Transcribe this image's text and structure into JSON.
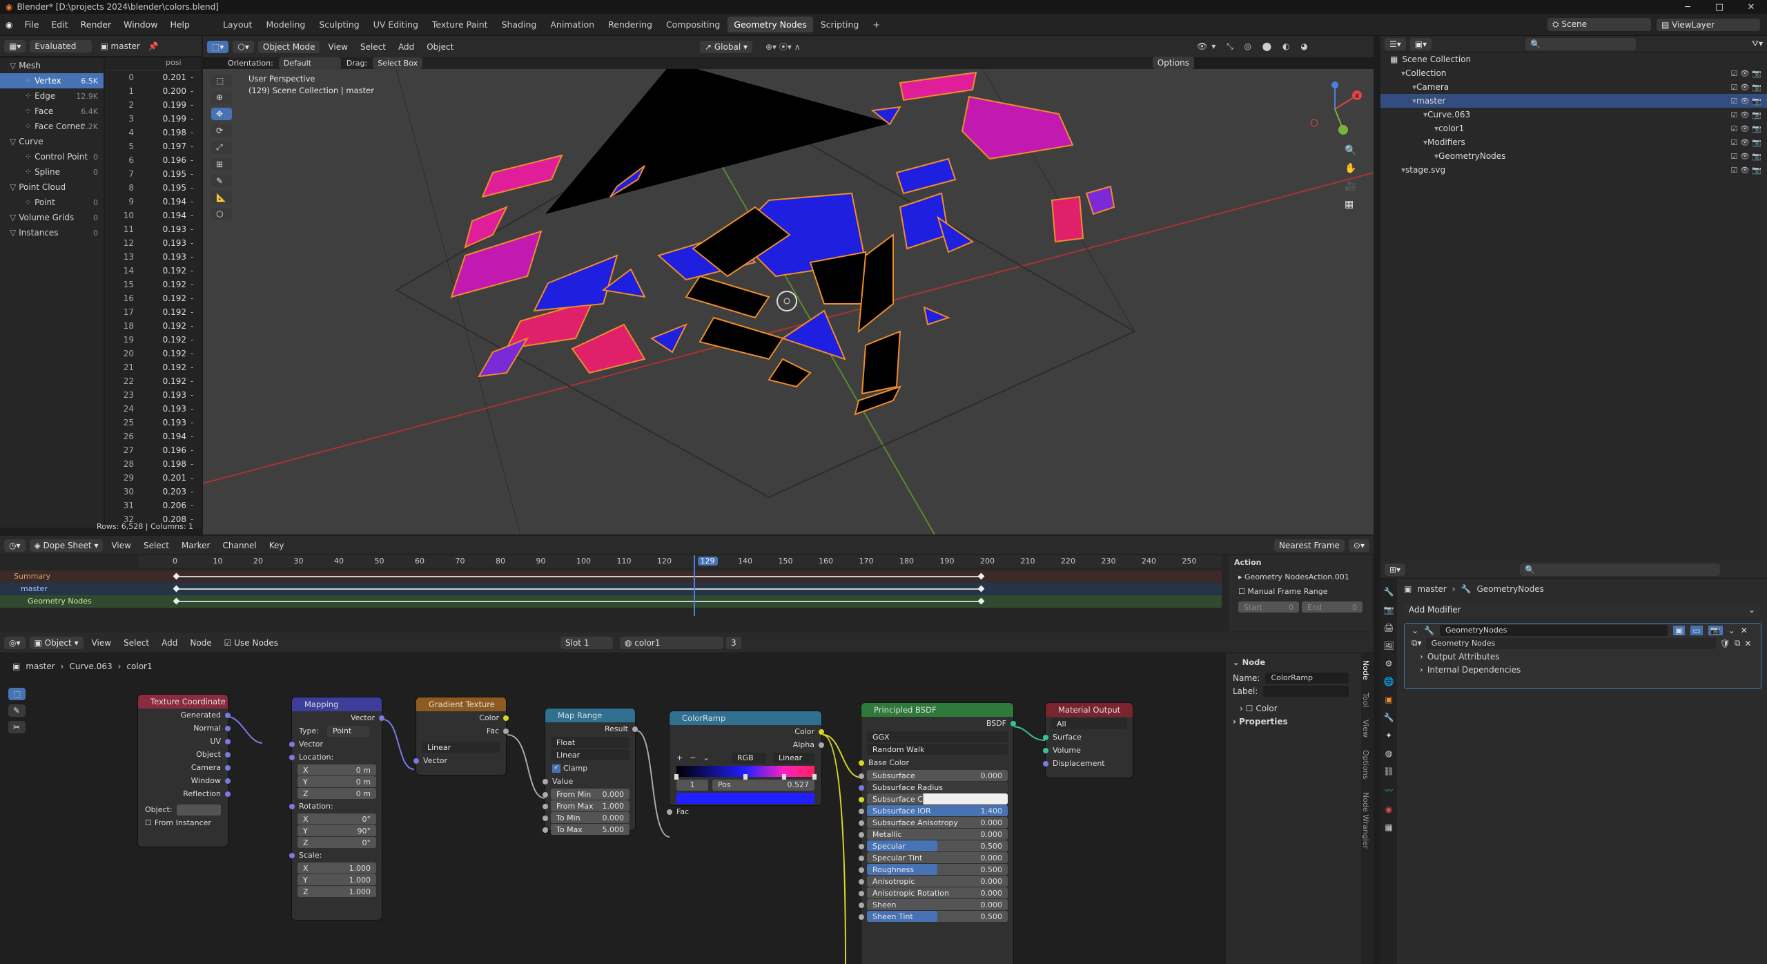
{
  "window": {
    "title": "Blender* [D:\\projects 2024\\blender\\colors.blend]",
    "minimize": "─",
    "maximize": "□",
    "close": "✕"
  },
  "menu": [
    "File",
    "Edit",
    "Render",
    "Window",
    "Help"
  ],
  "workspaces": [
    "Layout",
    "Modeling",
    "Sculpting",
    "UV Editing",
    "Texture Paint",
    "Shading",
    "Animation",
    "Rendering",
    "Compositing",
    "Geometry Nodes",
    "Scripting",
    "+"
  ],
  "active_workspace": "Geometry Nodes",
  "topright": {
    "scene": "Scene",
    "viewlayer": "ViewLayer"
  },
  "spreadsheet": {
    "mode": "Evaluated",
    "object": "master",
    "column_header": "posi",
    "tree": [
      {
        "label": "Mesh",
        "count": "",
        "indent": 0
      },
      {
        "label": "Vertex",
        "count": "6.5K",
        "indent": 1,
        "selected": true
      },
      {
        "label": "Edge",
        "count": "12.9K",
        "indent": 1
      },
      {
        "label": "Face",
        "count": "6.4K",
        "indent": 1
      },
      {
        "label": "Face Corner",
        "count": "2.2K",
        "indent": 1
      },
      {
        "label": "Curve",
        "count": "",
        "indent": 0
      },
      {
        "label": "Control Point",
        "count": "0",
        "indent": 1
      },
      {
        "label": "Spline",
        "count": "0",
        "indent": 1
      },
      {
        "label": "Point Cloud",
        "count": "",
        "indent": 0
      },
      {
        "label": "Point",
        "count": "0",
        "indent": 1
      },
      {
        "label": "Volume Grids",
        "count": "0",
        "indent": 0
      },
      {
        "label": "Instances",
        "count": "0",
        "indent": 0
      }
    ],
    "rows": [
      [
        "0",
        "0.201"
      ],
      [
        "1",
        "0.200"
      ],
      [
        "2",
        "0.199"
      ],
      [
        "3",
        "0.199"
      ],
      [
        "4",
        "0.198"
      ],
      [
        "5",
        "0.197"
      ],
      [
        "6",
        "0.196"
      ],
      [
        "7",
        "0.195"
      ],
      [
        "8",
        "0.195"
      ],
      [
        "9",
        "0.194"
      ],
      [
        "10",
        "0.194"
      ],
      [
        "11",
        "0.193"
      ],
      [
        "12",
        "0.193"
      ],
      [
        "13",
        "0.193"
      ],
      [
        "14",
        "0.192"
      ],
      [
        "15",
        "0.192"
      ],
      [
        "16",
        "0.192"
      ],
      [
        "17",
        "0.192"
      ],
      [
        "18",
        "0.192"
      ],
      [
        "19",
        "0.192"
      ],
      [
        "20",
        "0.192"
      ],
      [
        "21",
        "0.192"
      ],
      [
        "22",
        "0.192"
      ],
      [
        "23",
        "0.193"
      ],
      [
        "24",
        "0.193"
      ],
      [
        "25",
        "0.193"
      ],
      [
        "26",
        "0.194"
      ],
      [
        "27",
        "0.196"
      ],
      [
        "28",
        "0.198"
      ],
      [
        "29",
        "0.201"
      ],
      [
        "30",
        "0.203"
      ],
      [
        "31",
        "0.206"
      ],
      [
        "32",
        "0.208"
      ]
    ],
    "trailing": "-",
    "status": "Rows: 6,528  |  Columns: 1"
  },
  "viewport_header": {
    "mode": "Object Mode",
    "view": "View",
    "select": "Select",
    "add": "Add",
    "object": "Object",
    "orientation_label": "Orientation:",
    "orientation": "Default",
    "drag_label": "Drag:",
    "drag": "Select Box",
    "transform": "Global",
    "options": "Options"
  },
  "viewport_overlay": {
    "perspective": "User Perspective",
    "collection": "(129) Scene Collection | master"
  },
  "axis_labels": {
    "x": "X",
    "y": "Y",
    "z": "Z"
  },
  "outliner": {
    "root": "Scene Collection",
    "items": [
      {
        "label": "Collection",
        "indent": 1
      },
      {
        "label": "Camera",
        "indent": 2
      },
      {
        "label": "master",
        "indent": 2,
        "selected": true
      },
      {
        "label": "Curve.063",
        "indent": 3
      },
      {
        "label": "color1",
        "indent": 4
      },
      {
        "label": "Modifiers",
        "indent": 3
      },
      {
        "label": "GeometryNodes",
        "indent": 4
      },
      {
        "label": "stage.svg",
        "indent": 1
      }
    ]
  },
  "dopesheet": {
    "mode": "Dope Sheet",
    "menus": [
      "View",
      "Select",
      "Marker",
      "Channel",
      "Key"
    ],
    "snap": "Nearest Frame",
    "frames": [
      "0",
      "10",
      "20",
      "30",
      "40",
      "50",
      "60",
      "70",
      "80",
      "90",
      "100",
      "110",
      "120",
      "129",
      "140",
      "150",
      "160",
      "170",
      "180",
      "190",
      "200",
      "210",
      "220",
      "230",
      "240",
      "250"
    ],
    "current_frame": "129",
    "channels": [
      "Summary",
      "master",
      "Geometry Nodes"
    ],
    "action_panel": {
      "title": "Action",
      "name": "Geometry NodesAction.001",
      "manual": "Manual Frame Range",
      "start_label": "Start",
      "start": "0",
      "end_label": "End",
      "end": "0"
    }
  },
  "node_editor": {
    "mode": "Object",
    "menus": [
      "View",
      "Select",
      "Add",
      "Node"
    ],
    "use_nodes": "Use Nodes",
    "slot": "Slot 1",
    "material": "color1",
    "users": "3",
    "breadcrumb": [
      "master",
      "Curve.063",
      "color1"
    ],
    "tex_coord": {
      "title": "Texture Coordinate",
      "outputs": [
        "Generated",
        "Normal",
        "UV",
        "Object",
        "Camera",
        "Window",
        "Reflection"
      ],
      "object_label": "Object:",
      "from_instancer": "From Instancer"
    },
    "mapping": {
      "title": "Mapping",
      "out": "Vector",
      "type_label": "Type:",
      "type": "Point",
      "vector": "Vector",
      "location": "Location:",
      "loc": [
        [
          "X",
          "0 m"
        ],
        [
          "Y",
          "0 m"
        ],
        [
          "Z",
          "0 m"
        ]
      ],
      "rotation": "Rotation:",
      "rot": [
        [
          "X",
          "0°"
        ],
        [
          "Y",
          "90°"
        ],
        [
          "Z",
          "0°"
        ]
      ],
      "scale": "Scale:",
      "scl": [
        [
          "X",
          "1.000"
        ],
        [
          "Y",
          "1.000"
        ],
        [
          "Z",
          "1.000"
        ]
      ]
    },
    "gradient": {
      "title": "Gradient Texture",
      "out1": "Color",
      "out2": "Fac",
      "type": "Linear",
      "in": "Vector"
    },
    "maprange": {
      "title": "Map Range",
      "out": "Result",
      "dtype": "Float",
      "interp": "Linear",
      "clamp": "Clamp",
      "value": "Value",
      "fields": [
        [
          "From Min",
          "0.000"
        ],
        [
          "From Max",
          "1.000"
        ],
        [
          "To Min",
          "0.000"
        ],
        [
          "To Max",
          "5.000"
        ]
      ]
    },
    "colorramp": {
      "title": "ColorRamp",
      "out1": "Color",
      "out2": "Alpha",
      "mode": "RGB",
      "interp": "Linear",
      "index": "1",
      "pos_label": "Pos",
      "pos": "0.527",
      "in": "Fac",
      "plus": "+",
      "minus": "−",
      "stops": [
        0.0,
        0.5,
        0.78,
        1.0
      ]
    },
    "bsdf": {
      "title": "Principled BSDF",
      "out": "BSDF",
      "dist": "GGX",
      "sss": "Random Walk",
      "base": "Base Color",
      "fields": [
        [
          "Subsurface",
          "0.000",
          0
        ],
        [
          "Subsurface Radius",
          "",
          0
        ],
        [
          "Subsurface C...",
          "",
          0
        ],
        [
          "Subsurface IOR",
          "1.400",
          1
        ],
        [
          "Subsurface Anisotropy",
          "0.000",
          0
        ],
        [
          "Metallic",
          "0.000",
          0
        ],
        [
          "Specular",
          "0.500",
          0.5
        ],
        [
          "Specular Tint",
          "0.000",
          0
        ],
        [
          "Roughness",
          "0.500",
          0.5
        ],
        [
          "Anisotropic",
          "0.000",
          0
        ],
        [
          "Anisotropic Rotation",
          "0.000",
          0
        ],
        [
          "Sheen",
          "0.000",
          0
        ],
        [
          "Sheen Tint",
          "0.500",
          0.5
        ]
      ]
    },
    "output": {
      "title": "Material Output",
      "target": "All",
      "ins": [
        "Surface",
        "Volume",
        "Displacement"
      ]
    }
  },
  "node_sidebar": {
    "section": "Node",
    "name_label": "Name:",
    "name": "ColorRamp",
    "label_label": "Label:",
    "color": "Color",
    "properties": "Properties",
    "tabs": [
      "Node",
      "Tool",
      "View",
      "Options",
      "Node Wrangler"
    ]
  },
  "properties": {
    "breadcrumb": [
      "master",
      "GeometryNodes"
    ],
    "add_modifier": "Add Modifier",
    "modifier_name": "GeometryNodes",
    "node_group": "Geometry Nodes",
    "sub": [
      "Output Attributes",
      "Internal Dependencies"
    ]
  },
  "colors": {
    "accent": "#4772b3",
    "blue": "#1f1fe0",
    "magenta": "#e01e9a",
    "pink": "#e0206a",
    "orange": "#f08c28",
    "viewport": "#3f3f3f"
  }
}
